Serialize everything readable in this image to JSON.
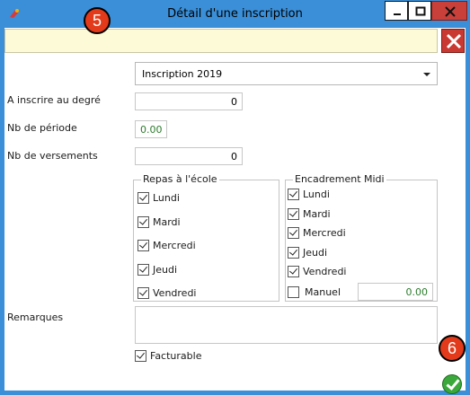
{
  "window": {
    "title": "Détail d'une inscription"
  },
  "badges": {
    "top": "5",
    "bottom": "6"
  },
  "form": {
    "select_value": "Inscription 2019",
    "degree_label": "A inscrire au  degré",
    "degree_value": "0",
    "periode_label": "Nb de période",
    "periode_value": "0.00",
    "versements_label": "Nb de versements",
    "versements_value": "0",
    "remarques_label": "Remarques",
    "facturable_label": "Facturable",
    "facturable_checked": true
  },
  "repas": {
    "title": "Repas à l'école",
    "items": [
      {
        "label": "Lundi",
        "checked": true
      },
      {
        "label": "Mardi",
        "checked": true
      },
      {
        "label": "Mercredi",
        "checked": true
      },
      {
        "label": "Jeudi",
        "checked": true
      },
      {
        "label": "Vendredi",
        "checked": true
      }
    ]
  },
  "encadrement": {
    "title": "Encadrement Midi",
    "items": [
      {
        "label": "Lundi",
        "checked": true
      },
      {
        "label": "Mardi",
        "checked": true
      },
      {
        "label": "Mercredi",
        "checked": true
      },
      {
        "label": "Jeudi",
        "checked": true
      },
      {
        "label": "Vendredi",
        "checked": true
      },
      {
        "label": "Manuel",
        "checked": false
      }
    ],
    "manuel_value": "0.00"
  },
  "colors": {
    "titlebar": "#3a8fd8",
    "badge": "#e23a1a",
    "yellow_bar": "#fdfbd7",
    "ok": "#3aa83a",
    "close_red": "#c93931"
  },
  "icons": {
    "app": "app-icon",
    "close": "close-icon",
    "ok": "checkmark-icon"
  }
}
